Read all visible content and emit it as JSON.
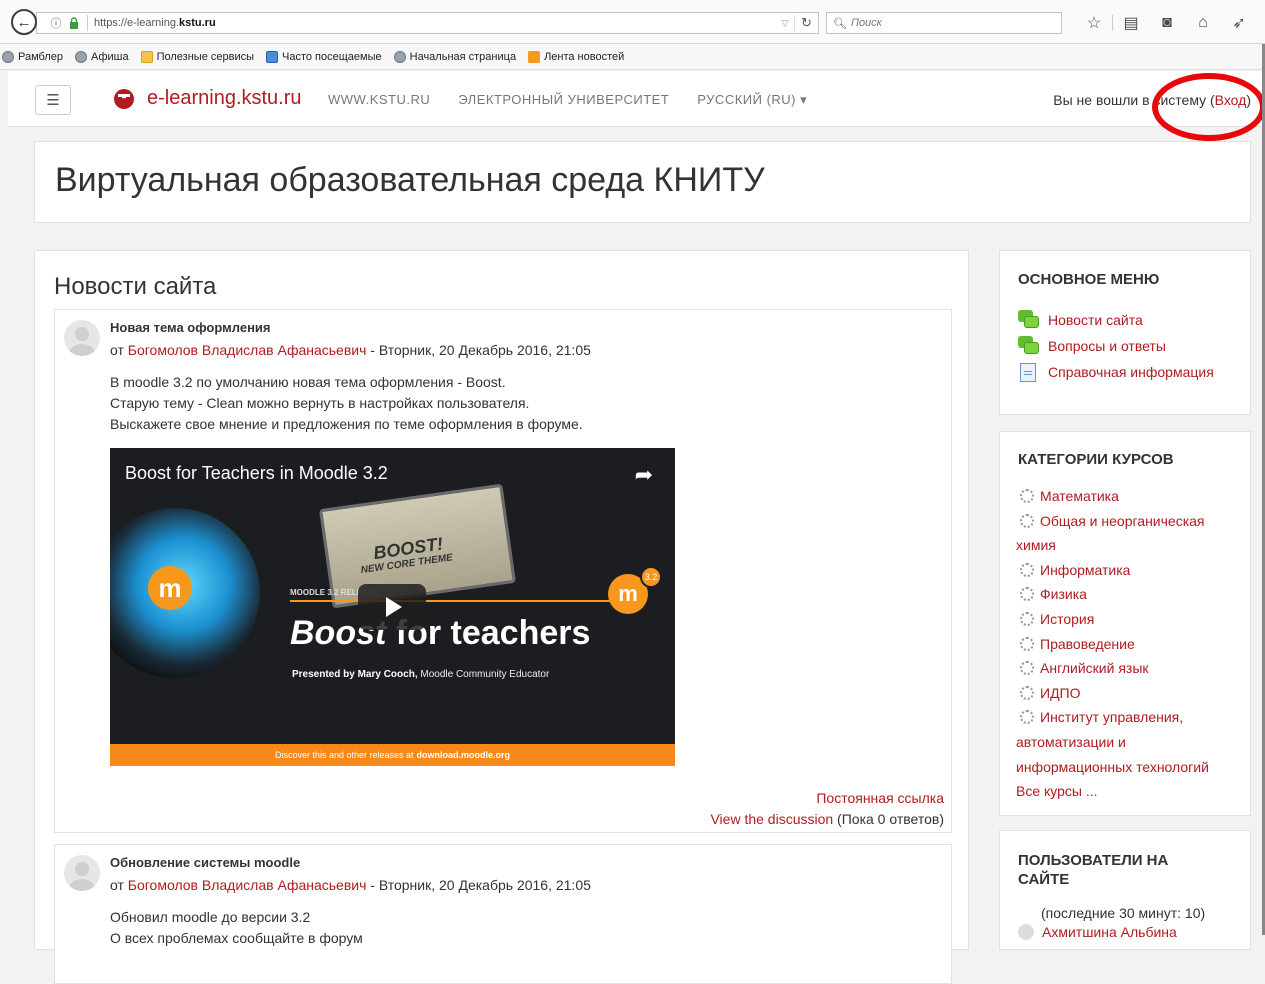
{
  "browser": {
    "url_prefix": "https://e-learning.",
    "url_domain": "kstu.ru",
    "search_placeholder": "Поиск",
    "bookmarks": [
      {
        "label": "Рамблер",
        "icon": "globe-icon"
      },
      {
        "label": "Афиша",
        "icon": "globe-icon"
      },
      {
        "label": "Полезные сервисы",
        "icon": "folder-icon"
      },
      {
        "label": "Часто посещаемые",
        "icon": "ie-page-icon"
      },
      {
        "label": "Начальная страница",
        "icon": "globe-icon"
      },
      {
        "label": "Лента новостей",
        "icon": "rss-icon"
      }
    ]
  },
  "navbar": {
    "brand": "e-learning.kstu.ru",
    "links": [
      "WWW.KSTU.RU",
      "ЭЛЕКТРОННЫЙ УНИВЕРСИТЕТ",
      "РУССКИЙ (RU) ▾"
    ],
    "login_text": "Вы не вошли в систему (",
    "login_link": "Вход",
    "login_close": ")"
  },
  "header": {
    "title": "Виртуальная образовательная среда КНИТУ"
  },
  "main": {
    "heading": "Новости сайта",
    "posts": [
      {
        "subject": "Новая тема оформления",
        "by": "от ",
        "author": "Богомолов Владислав Афанасьевич",
        "date": " - Вторник, 20 Декабрь 2016, 21:05",
        "body": [
          "В moodle 3.2 по умолчанию новая тема оформления - Boost.",
          "Старую тему - Clean можно вернуть в настройках пользователя.",
          "Выскажете свое мнение и предложения по теме оформления в форуме."
        ],
        "video": {
          "title": "Boost for Teachers in Moodle 3.2",
          "gauge_boost": "BOOST!",
          "gauge_sub": "NEW CORE THEME",
          "release": "MOODLE 3.2 RELEASE",
          "version": "3.2",
          "big_prefix": "Boost",
          "big_suffix": " for teachers",
          "presenter_name": "Presented by Mary Cooch,",
          "presenter_role": " Moodle Community Educator",
          "footer_text": "Discover this and other releases at",
          "footer_link": "download.moodle.org"
        },
        "permalink": "Постоянная ссылка",
        "discussion": "View the discussion",
        "replies": " (Пока 0 ответов)"
      },
      {
        "subject": "Обновление системы moodle",
        "by": "от ",
        "author": "Богомолов Владислав Афанасьевич",
        "date": " - Вторник, 20 Декабрь 2016, 21:05",
        "body": [
          "Обновил moodle до версии 3.2",
          "О всех проблемах сообщайте в форум"
        ]
      }
    ]
  },
  "sidebar": {
    "main_menu": {
      "title": "ОСНОВНОЕ МЕНЮ",
      "items": [
        "Новости сайта",
        "Вопросы и ответы",
        "Справочная информация"
      ]
    },
    "categories": {
      "title": "КАТЕГОРИИ КУРСОВ",
      "items": [
        "Математика",
        "Общая и неорганическая химия",
        "Информатика",
        "Физика",
        "История",
        "Правоведение",
        "Английский язык",
        "ИДПО",
        "Институт управления, автоматизации и информационных технологий"
      ],
      "all": "Все курсы ..."
    },
    "users": {
      "title": "ПОЛЬЗОВАТЕЛИ НА САЙТЕ",
      "subtitle": "(последние 30 минут: 10)",
      "first_user": "Ахмитшина Альбина"
    }
  }
}
